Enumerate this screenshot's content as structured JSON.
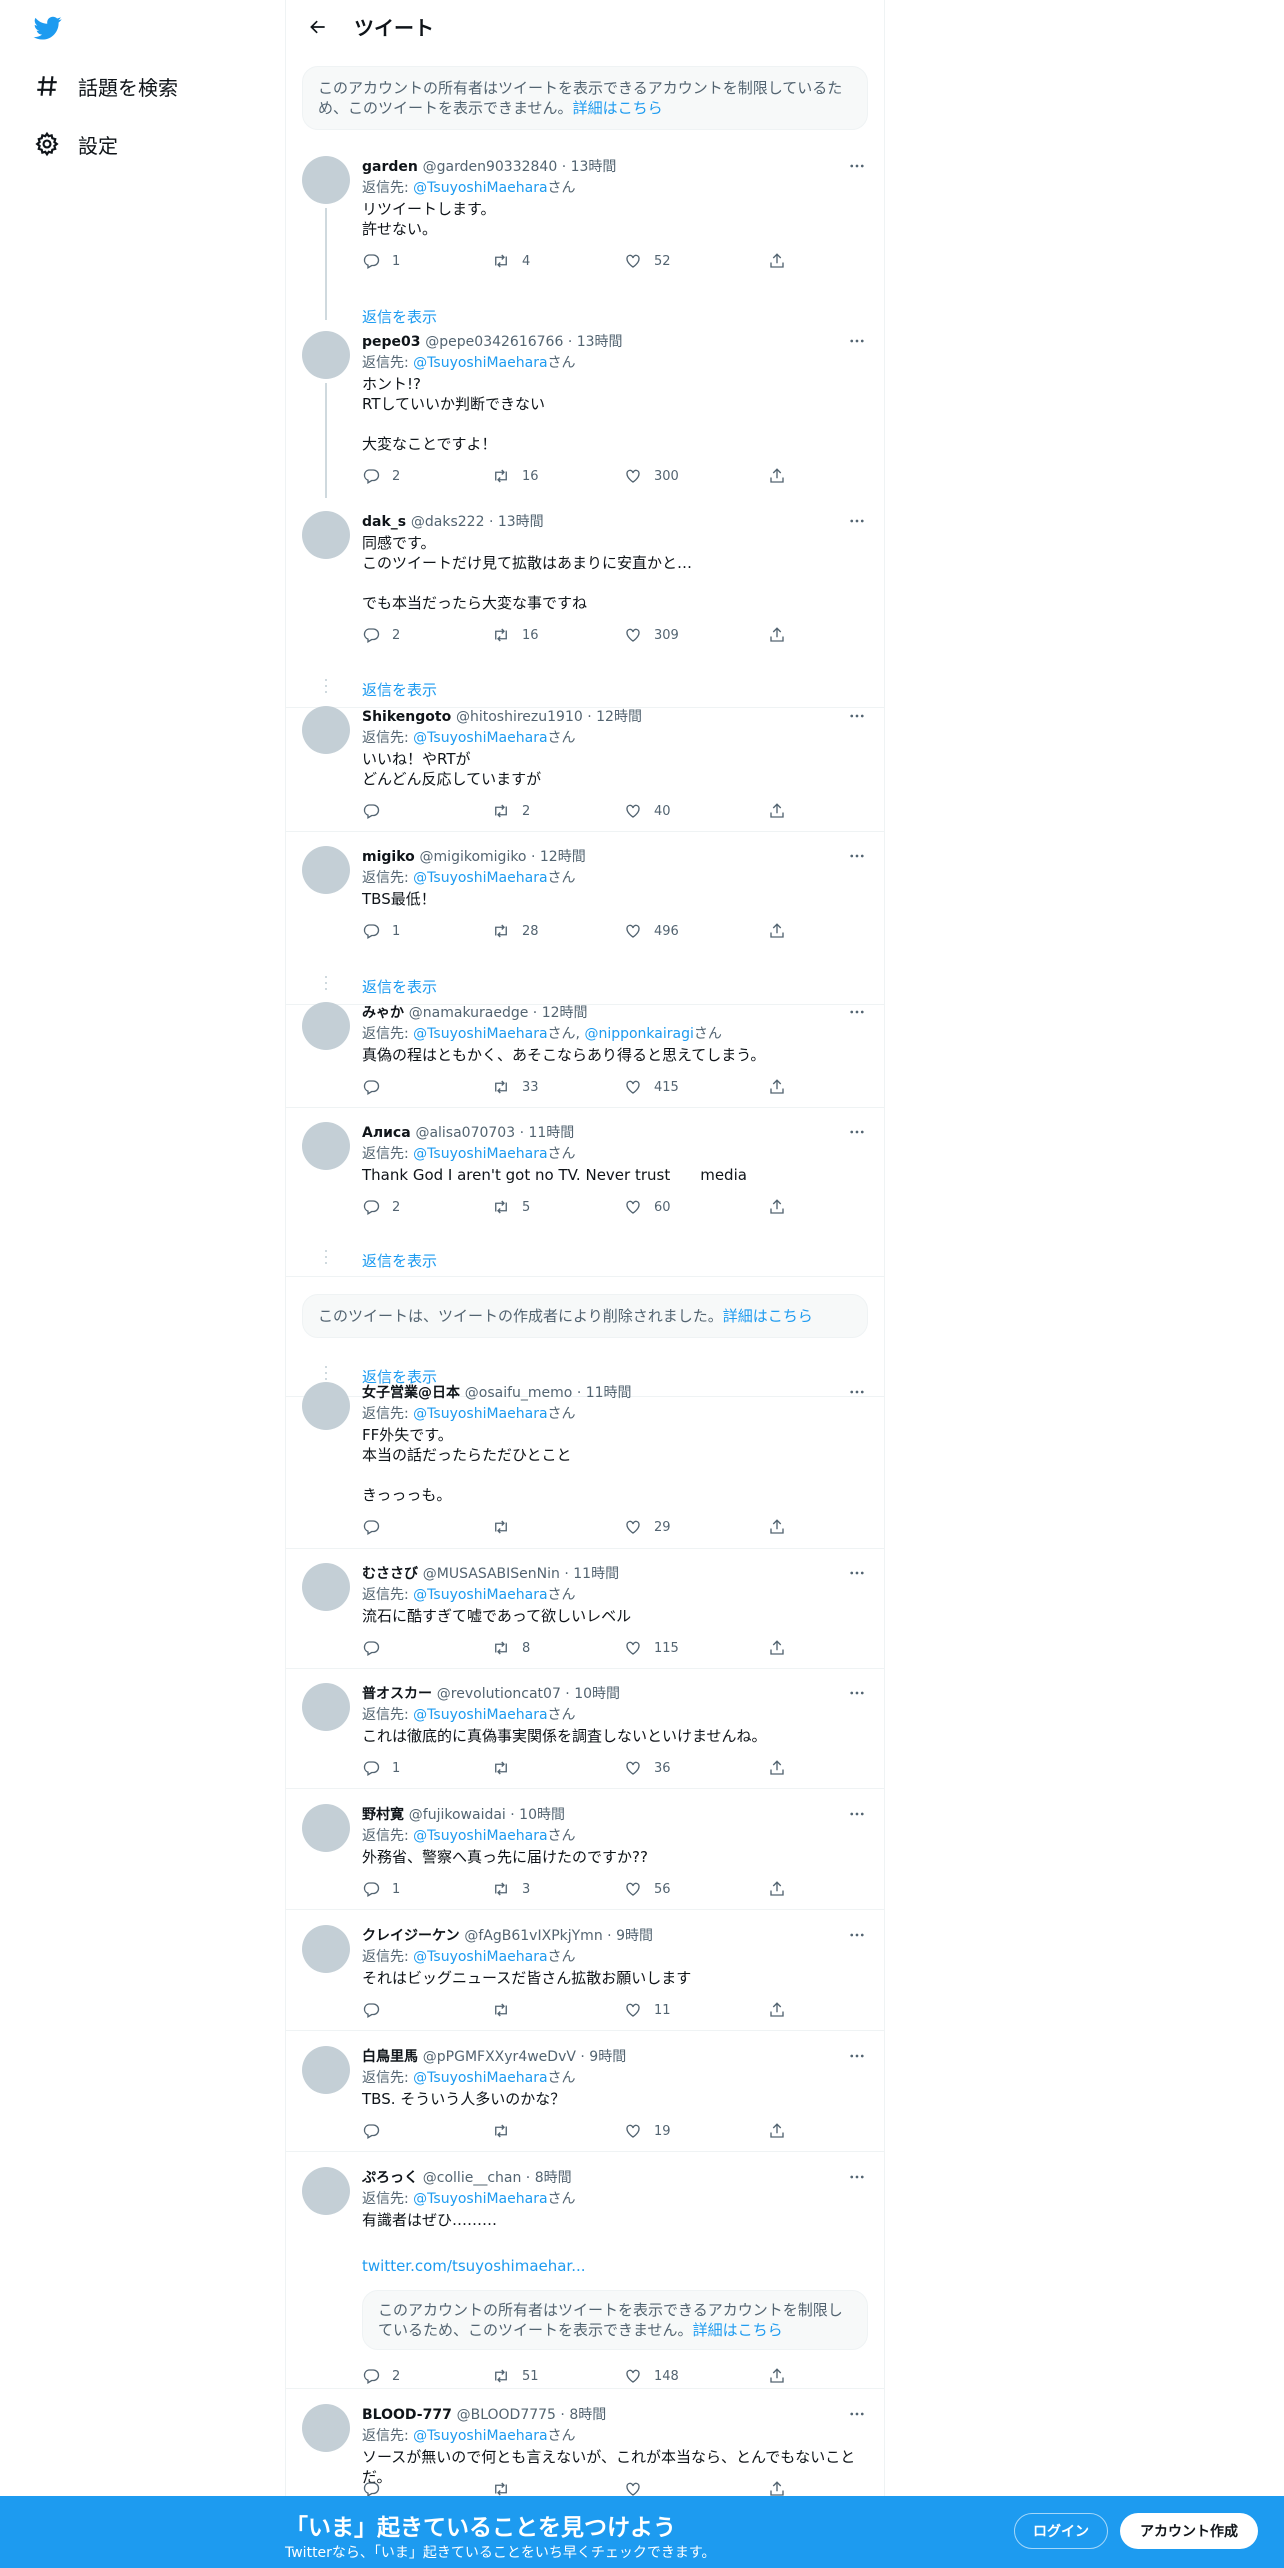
{
  "colors": {
    "accent": "#1d9bf0",
    "muted": "#536471",
    "text": "#0f1419"
  },
  "sidebar": {
    "logo_icon": "twitter-bird-icon",
    "items": [
      {
        "icon": "hash-icon",
        "label": "話題を検索"
      },
      {
        "icon": "gear-icon",
        "label": "設定"
      }
    ]
  },
  "header": {
    "title": "ツイート",
    "back_icon": "arrow-left-icon"
  },
  "notice": {
    "text": "このアカウントの所有者はツイートを表示できるアカウントを制限しているため、このツイートを表示できません。",
    "link": "詳細はこちら"
  },
  "deleted_notice": {
    "text": "このツイートは、ツイートの作成者により削除されました。",
    "link": "詳細はこちら"
  },
  "show_replies": "返信を表示",
  "reply_prefix": "返信先: ",
  "reply_suffix": "さん",
  "tweets": [
    {
      "name": "garden",
      "handle": "@garden90332840",
      "time": "13時間",
      "reply_to": "@TsuyoshiMaehara",
      "text": "リツイートします。\n許せない。",
      "replies": "1",
      "retweets": "4",
      "likes": "52"
    },
    {
      "name": "pepe03",
      "handle": "@pepe0342616766",
      "time": "13時間",
      "reply_to": "@TsuyoshiMaehara",
      "text": "ホント!?\nRTしていいか判断できない\n\n大変なことですよ！",
      "replies": "2",
      "retweets": "16",
      "likes": "300"
    },
    {
      "name": "dak_s",
      "handle": "@daks222",
      "time": "13時間",
      "text": "同感です。\nこのツイートだけ見て拡散はあまりに安直かと…\n\nでも本当だったら大変な事ですね",
      "replies": "2",
      "retweets": "16",
      "likes": "309"
    },
    {
      "name": "Shikengoto",
      "handle": "@hitoshirezu1910",
      "time": "12時間",
      "reply_to": "@TsuyoshiMaehara",
      "text": "いいね！やRTが\nどんどん反応していますが",
      "replies": "",
      "retweets": "2",
      "likes": "40"
    },
    {
      "name": "migiko",
      "handle": "@migikomigiko",
      "time": "12時間",
      "reply_to": "@TsuyoshiMaehara",
      "text": "TBS最低！",
      "replies": "1",
      "retweets": "28",
      "likes": "496"
    },
    {
      "name": "みゃか",
      "handle": "@namakuraedge",
      "time": "12時間",
      "reply_to": "@TsuyoshiMaehara",
      "reply_to2": "@nipponkairagi",
      "text": "真偽の程はともかく、あそこならあり得ると思えてしまう。",
      "replies": "",
      "retweets": "33",
      "likes": "415"
    },
    {
      "name": "Алиса",
      "handle": "@alisa070703",
      "time": "11時間",
      "reply_to": "@TsuyoshiMaehara",
      "text": "Thank God I aren't got no TV. Never trust　　media",
      "replies": "2",
      "retweets": "5",
      "likes": "60"
    },
    {
      "name": "女子営業@日本",
      "handle": "@osaifu_memo",
      "time": "11時間",
      "reply_to": "@TsuyoshiMaehara",
      "text": "FF外失です。\n本当の話だったらただひとこと\n\nきっっっも。",
      "replies": "",
      "retweets": "",
      "likes": "29"
    },
    {
      "name": "むささび",
      "handle": "@MUSASABISenNin",
      "time": "11時間",
      "reply_to": "@TsuyoshiMaehara",
      "text": "流石に酷すぎて嘘であって欲しいレベル",
      "replies": "",
      "retweets": "8",
      "likes": "115"
    },
    {
      "name": "普オスカー",
      "handle": "@revolutioncat07",
      "time": "10時間",
      "reply_to": "@TsuyoshiMaehara",
      "text": "これは徹底的に真偽事実関係を調査しないといけませんね。",
      "replies": "1",
      "retweets": "",
      "likes": "36"
    },
    {
      "name": "野村寛",
      "handle": "@fujikowaidai",
      "time": "10時間",
      "reply_to": "@TsuyoshiMaehara",
      "text": "外務省、警察へ真っ先に届けたのですか??",
      "replies": "1",
      "retweets": "3",
      "likes": "56"
    },
    {
      "name": "クレイジーケン",
      "handle": "@fAgB61vIXPkjYmn",
      "time": "9時間",
      "reply_to": "@TsuyoshiMaehara",
      "text": "それはビッグニュースだ皆さん拡散お願いします",
      "replies": "",
      "retweets": "",
      "likes": "11"
    },
    {
      "name": "白鳥里馬",
      "handle": "@pPGMFXXyr4weDvV",
      "time": "9時間",
      "reply_to": "@TsuyoshiMaehara",
      "text": "TBS. そういう人多いのかな？",
      "replies": "",
      "retweets": "",
      "likes": "19"
    },
    {
      "name": "ぷろっく",
      "handle": "@collie__chan",
      "time": "8時間",
      "reply_to": "@TsuyoshiMaehara",
      "text": "有識者はぜひ………",
      "link": "twitter.com/tsuyoshimaehar...",
      "replies": "2",
      "retweets": "51",
      "likes": "148"
    },
    {
      "name": "BLOOD-777",
      "handle": "@BLOOD7775",
      "time": "8時間",
      "reply_to": "@TsuyoshiMaehara",
      "text": "ソースが無いので何とも言えないが、これが本当なら、とんでもないことだ。",
      "replies": "",
      "retweets": "",
      "likes": ""
    }
  ],
  "bottom_bar": {
    "title": "「いま」起きていることを見つけよう",
    "subtitle": "Twitterなら、「いま」起きていることをいち早くチェックできます。",
    "login": "ログイン",
    "signup": "アカウント作成"
  }
}
